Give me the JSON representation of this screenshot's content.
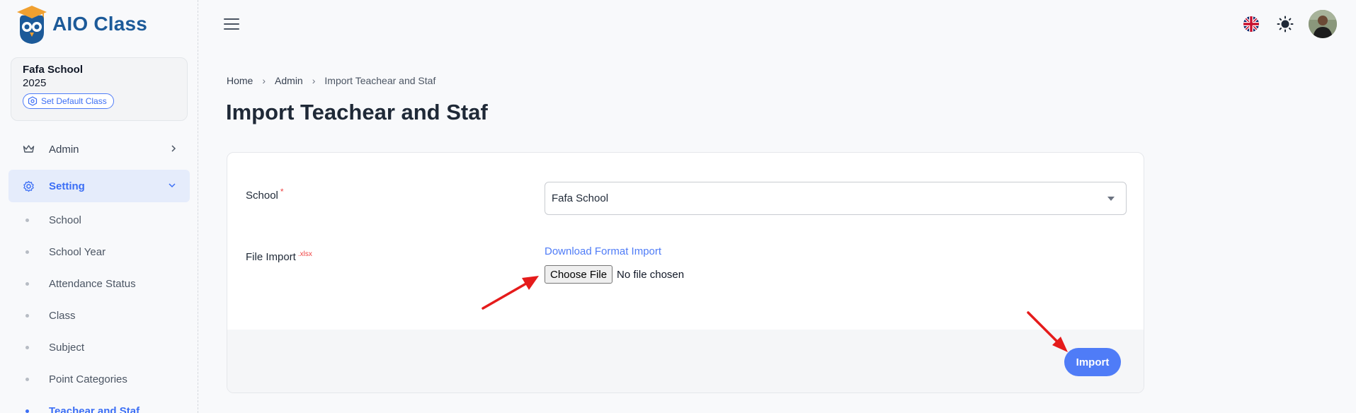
{
  "app": {
    "name": "AIO Class"
  },
  "school_card": {
    "school": "Fafa School",
    "year": "2025",
    "set_default": "Set Default Class"
  },
  "nav": {
    "admin": "Admin",
    "setting": "Setting",
    "sub_items": [
      "School",
      "School Year",
      "Attendance Status",
      "Class",
      "Subject",
      "Point Categories",
      "Teachear and Staf"
    ]
  },
  "breadcrumb": {
    "home": "Home",
    "admin": "Admin",
    "current": "Import Teachear and Staf"
  },
  "page": {
    "title": "Import Teachear and Staf"
  },
  "form": {
    "school_label": "School",
    "school_required": "*",
    "school_value": "Fafa School",
    "file_label": "File Import",
    "file_hint": ".xlsx",
    "download_link": "Download Format Import",
    "choose_file": "Choose File",
    "no_file": "No file chosen",
    "import_button": "Import"
  },
  "colors": {
    "brand": "#1c5a99",
    "accent": "#4f7cf7",
    "annotation": "#e51b1b"
  },
  "icons": {
    "menu": "hamburger-icon",
    "language": "uk-flag-icon",
    "theme": "sun-icon",
    "admin": "crown-icon",
    "setting": "gear-icon"
  }
}
